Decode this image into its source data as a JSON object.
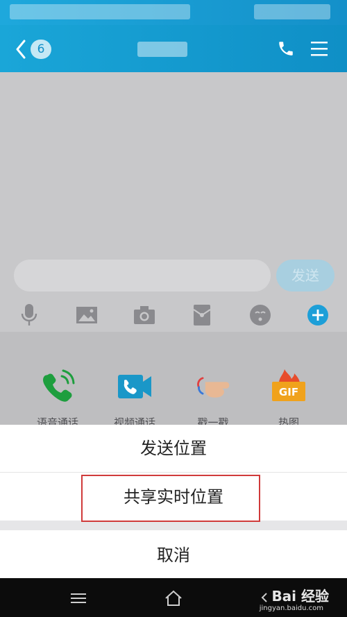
{
  "header": {
    "back_badge": "6",
    "icons": [
      "back-chevron-icon",
      "phone-icon",
      "menu-icon"
    ]
  },
  "input": {
    "send_label": "发送",
    "tools": [
      "microphone-icon",
      "image-icon",
      "camera-icon",
      "red-packet-icon",
      "emoji-icon",
      "plus-icon"
    ]
  },
  "apps": [
    {
      "label": "语音通话",
      "icon": "voice-call-icon"
    },
    {
      "label": "视频通话",
      "icon": "video-call-icon"
    },
    {
      "label": "戳一戳",
      "icon": "poke-icon"
    },
    {
      "label": "热图",
      "icon": "gif-icon"
    }
  ],
  "sheet": {
    "option1": "发送位置",
    "option2": "共享实时位置",
    "cancel": "取消"
  },
  "watermark": {
    "text": "Bai 经验",
    "sub": "jingyan.baidu.com"
  },
  "colors": {
    "accent": "#1aa6d8",
    "highlight_border": "#d03a3a",
    "send_button": "#a8cfe0"
  }
}
